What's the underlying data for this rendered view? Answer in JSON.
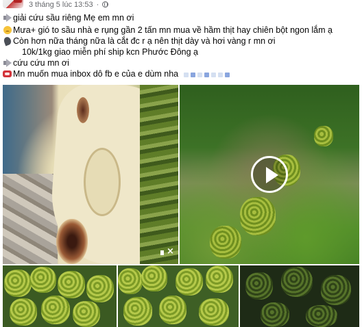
{
  "post": {
    "timestamp": "3 tháng 5 lúc 13:53",
    "separator": "·",
    "audience_icon": "globe-icon",
    "lines": [
      {
        "icon": "megaphone-icon",
        "text": "giải cứu sầu riêng Mẹ em mn ơi"
      },
      {
        "icon": "sad-face-icon",
        "text": "Mưa+ gió to sầu nhà e rụng gần 2 tấn mn mua về hầm thịt hay chiên bột ngon lắm ạ"
      },
      {
        "icon": "leaf-icon",
        "text": "Còn hơn nữa tháng nữa là cắt đc r ạ nên thịt dày và hơi vàng r mn ơi"
      },
      {
        "icon": "",
        "text": "10k/1kg giao miễn phí ship kcn Phước Đông ạ"
      },
      {
        "icon": "megaphone-icon",
        "text": "cứu cứu mn ơi"
      },
      {
        "icon": "phone-icon",
        "text": "Mn muốn mua inbox dô fb e của e dùm nha"
      }
    ]
  },
  "media": {
    "video_play_icon": "play-icon",
    "mute_icon": "mute-icon"
  }
}
